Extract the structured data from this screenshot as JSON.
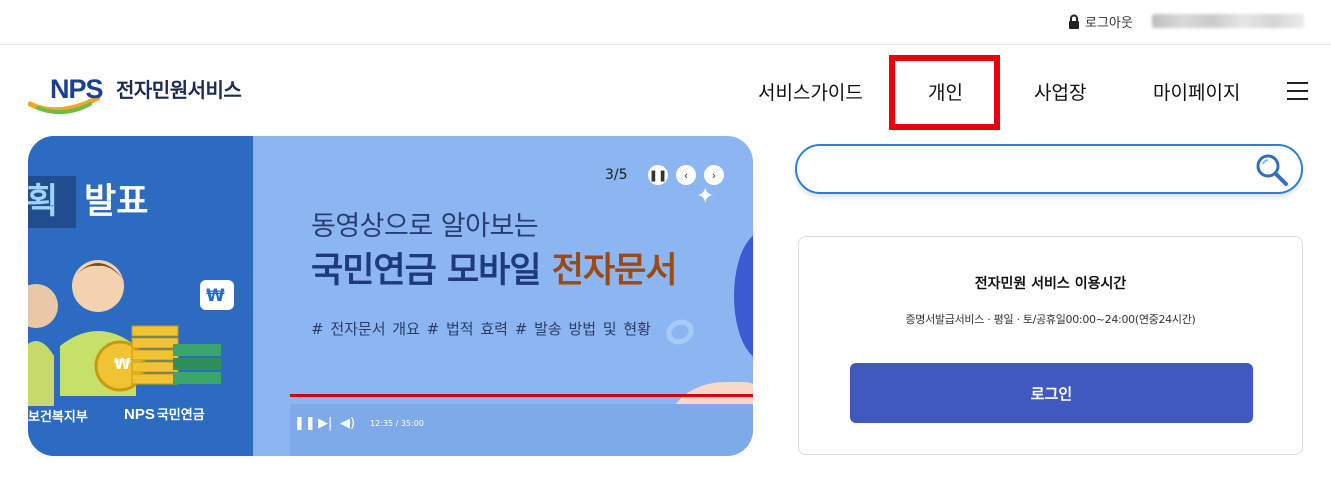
{
  "utility": {
    "logout_label": "로그아웃",
    "lock_icon": "lock-icon"
  },
  "header": {
    "logo_letters": "NPS",
    "logo_text": "전자민원서비스",
    "nav": {
      "guide": "서비스가이드",
      "personal": "개인",
      "business": "사업장",
      "mypage": "마이페이지"
    },
    "menu_icon": "hamburger-menu-icon",
    "highlight_color": "#e8000b"
  },
  "banner": {
    "left_title_a": "획",
    "left_title_b": "발표",
    "org_text": "보건복지부",
    "nps_small_letters": "NPS",
    "nps_small_text": "국민연금",
    "won_symbol": "₩",
    "pager": "3/5",
    "subtitle": "동영상으로 알아보는",
    "main_title_a": "국민연금 모바일 ",
    "main_title_b": "전자문서",
    "tags": "# 전자문서 개요   # 법적 효력   # 발송 방법 및 현황",
    "player_time": "12:35 / 35:00",
    "accent_color": "#9a4a12"
  },
  "search": {
    "value": "",
    "placeholder": ""
  },
  "info_card": {
    "title": "전자민원 서비스 이용시간",
    "description": "증명서발급서비스 · 평일 · 토/공휴일00:00~24:00(연중24시간)",
    "login_label": "로그인",
    "button_color": "#3f59bf"
  }
}
